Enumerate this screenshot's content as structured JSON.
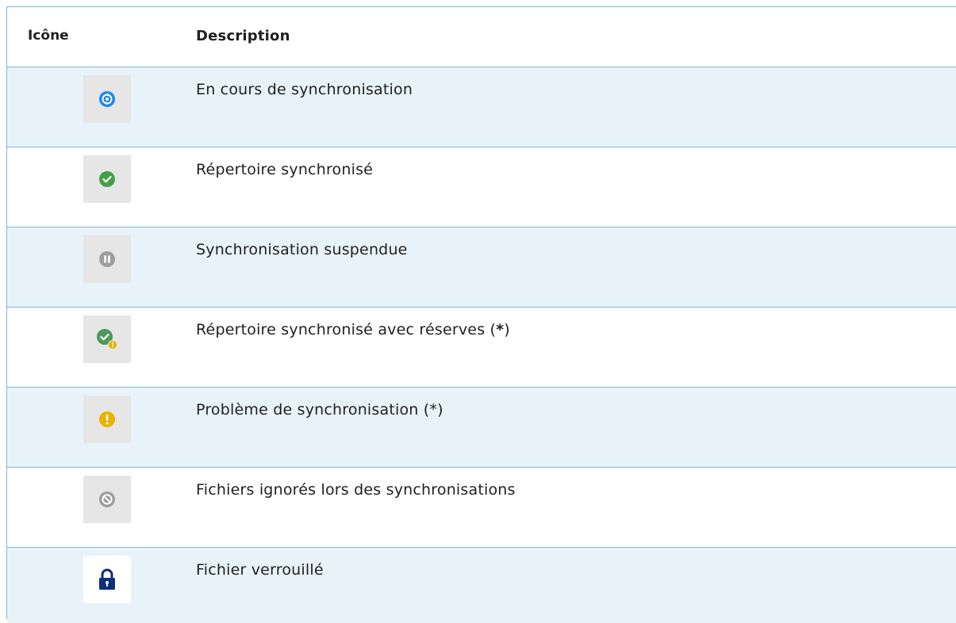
{
  "header": {
    "icon_col": "Icône",
    "desc_col": "Description"
  },
  "rows": [
    {
      "icon": "syncing-icon",
      "description": "En cours de synchronisation"
    },
    {
      "icon": "synced-check-icon",
      "description": "Répertoire synchronisé"
    },
    {
      "icon": "paused-icon",
      "description": "Synchronisation suspendue"
    },
    {
      "icon": "synced-warning-icon",
      "description_main": "Répertoire synchronisé avec réserves (",
      "description_star": "*",
      "description_end": ")"
    },
    {
      "icon": "warning-icon",
      "description": "Problème de synchronisation (*)"
    },
    {
      "icon": "ignored-icon",
      "description": "Fichiers ignorés lors des synchronisations"
    },
    {
      "icon": "lock-icon",
      "description": "Fichier verrouillé"
    }
  ],
  "colors": {
    "border": "#7fb6d8",
    "row_shaded": "#e8f3f9",
    "sync_blue": "#1e88e5",
    "ok_green": "#43a047",
    "pause_grey": "#9e9e9e",
    "warn_yellow": "#e6b400",
    "lock_navy": "#0d2f7a"
  }
}
